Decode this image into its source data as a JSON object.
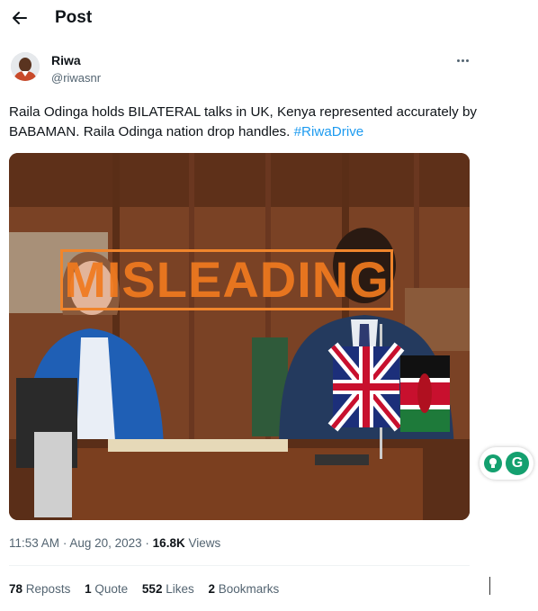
{
  "header": {
    "title": "Post"
  },
  "author": {
    "name": "Riwa",
    "handle": "@riwasnr"
  },
  "tweet": {
    "text": "Raila Odinga holds BILATERAL talks in UK, Kenya represented accurately by BABAMAN. Raila Odinga nation drop handles. ",
    "hashtag": "#RiwaDrive"
  },
  "media": {
    "overlay_label": "MISLEADING"
  },
  "meta": {
    "time": "11:53 AM",
    "date": "Aug 20, 2023",
    "views_count": "16.8K",
    "views_label": "Views"
  },
  "stats": {
    "reposts_count": "78",
    "reposts_label": "Reposts",
    "quotes_count": "1",
    "quotes_label": "Quote",
    "likes_count": "552",
    "likes_label": "Likes",
    "bookmarks_count": "2",
    "bookmarks_label": "Bookmarks"
  },
  "widget": {
    "badge": "G"
  },
  "colors": {
    "accent": "#1d9bf0",
    "overlay": "#f0852c",
    "widget": "#14a06f"
  }
}
